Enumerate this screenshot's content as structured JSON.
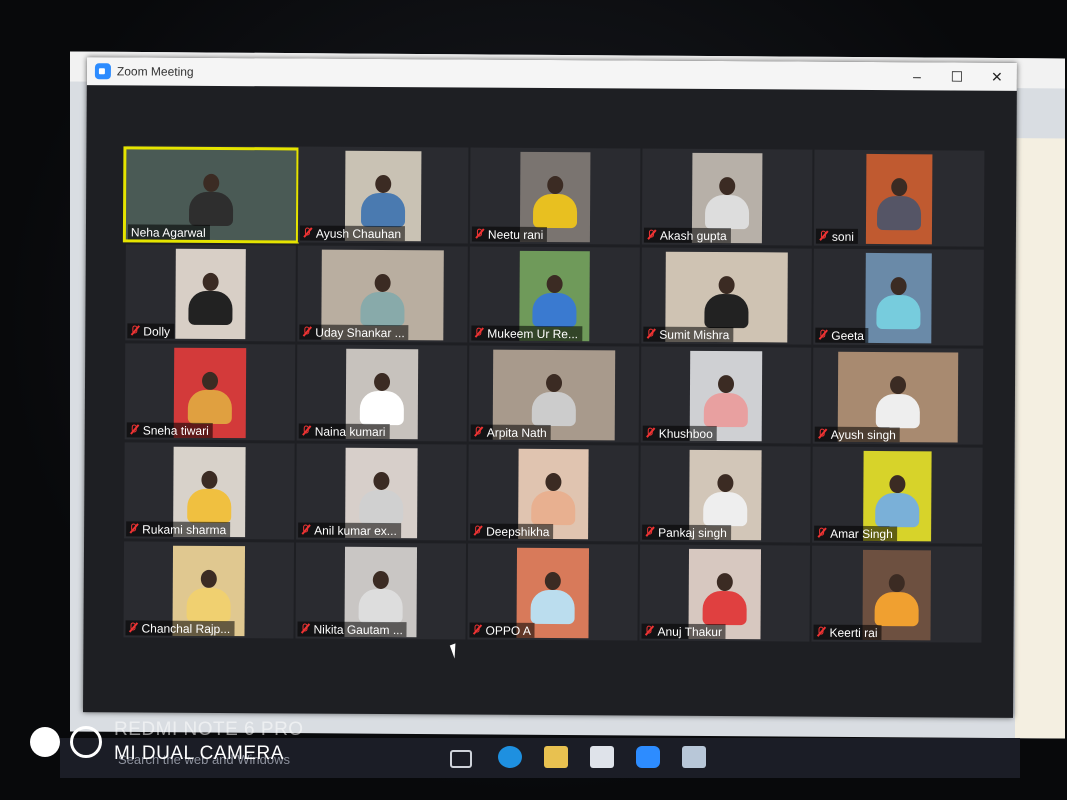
{
  "window": {
    "title": "Zoom Meeting",
    "minimize_glyph": "–",
    "maximize_glyph": "☐",
    "close_glyph": "✕"
  },
  "accent_color": "#e5e400",
  "muted_icon_color": "#ee3333",
  "participants": [
    {
      "name": "Neha Agarwal",
      "muted": false,
      "active_speaker": true
    },
    {
      "name": "Ayush Chauhan",
      "muted": true
    },
    {
      "name": "Neetu rani",
      "muted": true
    },
    {
      "name": "Akash gupta",
      "muted": true
    },
    {
      "name": "soni",
      "muted": true
    },
    {
      "name": "Dolly",
      "muted": true
    },
    {
      "name": "Uday Shankar ...",
      "muted": true
    },
    {
      "name": "Mukeem Ur Re...",
      "muted": true
    },
    {
      "name": "Sumit Mishra",
      "muted": true
    },
    {
      "name": "Geeta",
      "muted": true
    },
    {
      "name": "Sneha tiwari",
      "muted": true
    },
    {
      "name": "Naina kumari",
      "muted": true
    },
    {
      "name": "Arpita Nath",
      "muted": true
    },
    {
      "name": "Khushboo",
      "muted": true
    },
    {
      "name": "Ayush singh",
      "muted": true
    },
    {
      "name": "Rukami sharma",
      "muted": true
    },
    {
      "name": "Anil kumar ex...",
      "muted": true
    },
    {
      "name": "Deepshikha",
      "muted": true
    },
    {
      "name": "Pankaj singh",
      "muted": true
    },
    {
      "name": "Amar Singh",
      "muted": true
    },
    {
      "name": "Chanchal Rajp...",
      "muted": true
    },
    {
      "name": "Nikita Gautam ...",
      "muted": true
    },
    {
      "name": "OPPO A",
      "muted": true
    },
    {
      "name": "Anuj Thakur",
      "muted": true
    },
    {
      "name": "Keerti rai",
      "muted": true
    }
  ],
  "watermark": {
    "line1": "REDMI NOTE 6 PRO",
    "line2": "MI DUAL CAMERA"
  },
  "taskbar": {
    "search_placeholder": "Search the web and Windows",
    "icons": [
      "task-view-icon",
      "edge-icon",
      "file-explorer-icon",
      "store-icon",
      "zoom-icon",
      "app-icon"
    ]
  }
}
